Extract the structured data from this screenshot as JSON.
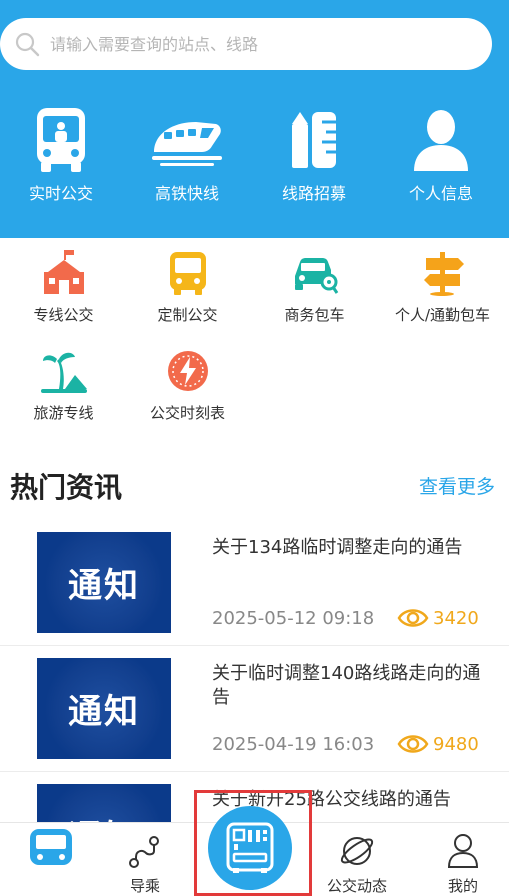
{
  "search": {
    "placeholder": "请输入需要查询的站点、线路"
  },
  "top_icons": [
    {
      "label": "实时公交",
      "icon": "bus-front-icon"
    },
    {
      "label": "高铁快线",
      "icon": "high-speed-train-icon"
    },
    {
      "label": "线路招募",
      "icon": "ruler-pencil-icon"
    },
    {
      "label": "个人信息",
      "icon": "person-icon"
    }
  ],
  "grid_items": [
    {
      "label": "专线公交",
      "icon": "school-building-icon",
      "color": "#f26a4b"
    },
    {
      "label": "定制公交",
      "icon": "bus-icon",
      "color": "#f5b619"
    },
    {
      "label": "商务包车",
      "icon": "car-key-icon",
      "color": "#1bb3a4"
    },
    {
      "label": "个人/通勤包车",
      "icon": "signpost-icon",
      "color": "#f5a31a"
    },
    {
      "label": "旅游专线",
      "icon": "palm-island-icon",
      "color": "#1bb3a4"
    },
    {
      "label": "公交时刻表",
      "icon": "clock-lightning-icon",
      "color": "#f26a4b"
    }
  ],
  "news": {
    "title": "热门资讯",
    "more": "查看更多",
    "thumb_text": "通知",
    "items": [
      {
        "title": "关于134路临时调整走向的通告",
        "date": "2025-05-12 09:18",
        "views": "3420"
      },
      {
        "title": "关于临时调整140路线路走向的通告",
        "date": "2025-04-19 16:03",
        "views": "9480"
      },
      {
        "title": "关于新开25路公交线路的通告",
        "date": "",
        "views": ""
      }
    ]
  },
  "bottom_nav": [
    {
      "label": "",
      "icon": "bus-tab-icon"
    },
    {
      "label": "导乘",
      "icon": "route-icon"
    },
    {
      "label": "",
      "icon": "scan-bus-code-icon"
    },
    {
      "label": "公交动态",
      "icon": "planet-icon"
    },
    {
      "label": "我的",
      "icon": "user-icon"
    }
  ],
  "colors": {
    "primary": "#2aa6e8",
    "views": "#f0a81c",
    "thumb_bg": "#0b3a8a",
    "highlight": "#e23a3a"
  }
}
